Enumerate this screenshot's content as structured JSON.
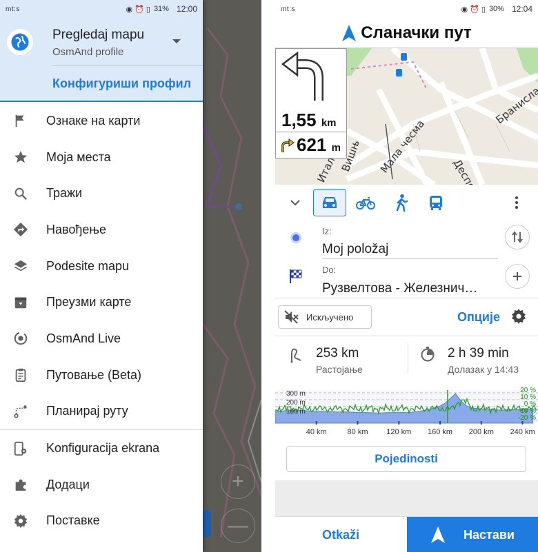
{
  "left": {
    "status": {
      "carrier": "mt:s",
      "icons": "◉ ⏰ ▯",
      "battery": "31%",
      "time": "12:00"
    },
    "profile": {
      "title": "Pregledaj mapu",
      "subtitle": "OsmAnd profile",
      "configure": "Конфигуриши профил"
    },
    "menu": [
      {
        "label": "Ознаке на карти",
        "icon": "flag-icon"
      },
      {
        "label": "Моја места",
        "icon": "star-icon"
      },
      {
        "label": "Тражи",
        "icon": "search-icon"
      },
      {
        "label": "Навођење",
        "icon": "directions-icon"
      },
      {
        "label": "Podesite mapu",
        "icon": "layers-icon"
      },
      {
        "label": "Преузми карте",
        "icon": "download-icon"
      },
      {
        "label": "OsmAnd Live",
        "icon": "live-update-icon"
      },
      {
        "label": "Путовање (Beta)",
        "icon": "clipboard-icon"
      },
      {
        "label": "Планирај руту",
        "icon": "route-plan-icon"
      },
      {
        "label": "Konfiguracija ekrana",
        "icon": "screen-config-icon"
      },
      {
        "label": "Додаци",
        "icon": "puzzle-icon"
      },
      {
        "label": "Поставке",
        "icon": "gear-icon"
      }
    ],
    "map_zoom_in": "+",
    "map_zoom_out": "—"
  },
  "right": {
    "status": {
      "carrier": "mt:s",
      "icons": "◉ ⏰ ▯",
      "battery": "30%",
      "time": "12:04"
    },
    "street": "Сланачки пут",
    "turn_distance": "1,55",
    "turn_unit": "km",
    "next_turn_distance": "621",
    "next_turn_unit": "m",
    "map_labels": [
      "Браниславa",
      "Мала чесма",
      "Деспо",
      "Вишњ",
      "Италска"
    ],
    "from_label": "Iz:",
    "from_value": "Мој položaj",
    "to_label": "Do:",
    "to_value": "Рузвелтова - Железнич…",
    "sound_label": "Искључено",
    "options_label": "Опције",
    "distance": "253 km",
    "distance_label": "Растојање",
    "time": "2 h 39 min",
    "arrival": "Долазак у 14:43",
    "details_label": "Pojedinosti",
    "cancel_label": "Otkaži",
    "start_label": "Настави",
    "colors": {
      "accent": "#1e7be0",
      "elevation_fill": "#8aa9e8",
      "slope_line": "#2a9a2a"
    }
  },
  "chart_data": {
    "type": "area",
    "x": [
      0,
      10,
      20,
      30,
      40,
      50,
      60,
      70,
      80,
      90,
      100,
      110,
      120,
      130,
      140,
      150,
      160,
      165,
      170,
      175,
      180,
      185,
      190,
      200,
      210,
      220,
      230,
      240,
      250
    ],
    "series": [
      {
        "values": [
          150,
          155,
          160,
          155,
          150,
          150,
          145,
          145,
          140,
          140,
          135,
          140,
          140,
          140,
          150,
          170,
          195,
          220,
          260,
          300,
          240,
          200,
          180,
          170,
          165,
          160,
          165,
          165,
          170
        ]
      }
    ],
    "xlabel": "",
    "x_ticks": [
      "40 km",
      "80 km",
      "120 km",
      "160 km",
      "200 km",
      "240 km"
    ],
    "y_ticks_left": [
      "300 m",
      "200 m",
      "100 m"
    ],
    "y_ticks_right": [
      "20 %",
      "10 %",
      "0 %",
      "-10 %",
      "-20 %"
    ],
    "ylim": [
      50,
      330
    ],
    "xlim": [
      0,
      255
    ],
    "grid": true
  }
}
